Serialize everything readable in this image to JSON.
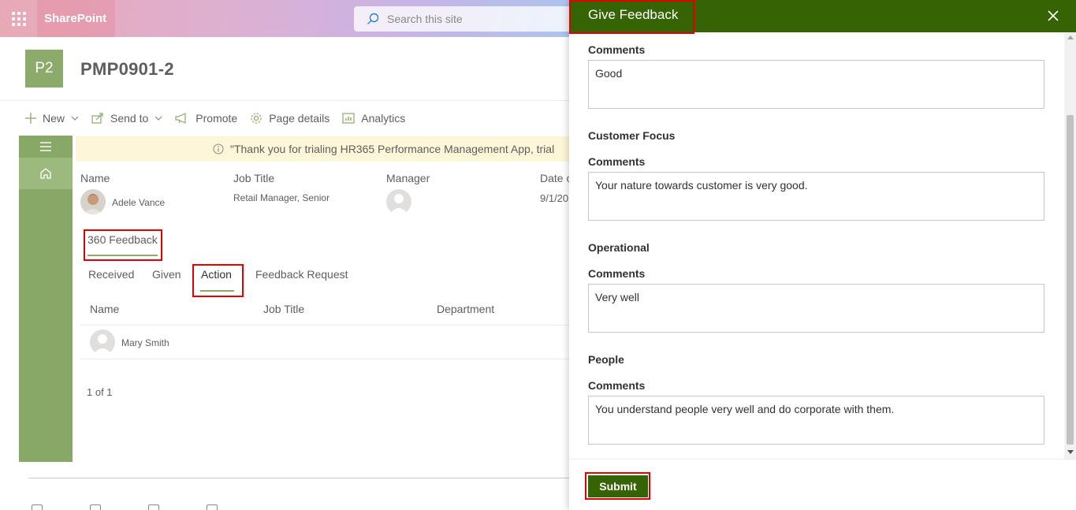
{
  "suitebar": {
    "app_name": "SharePoint",
    "search_placeholder": "Search this site"
  },
  "site": {
    "logo_initials": "P2",
    "title": "PMP0901-2"
  },
  "commandbar": {
    "new_label": "New",
    "send_to_label": "Send to",
    "promote_label": "Promote",
    "page_details_label": "Page details",
    "analytics_label": "Analytics"
  },
  "notice": {
    "text": "\"Thank you for trialing HR365 Performance Management App, trial"
  },
  "employee": {
    "name_label": "Name",
    "name_value": "Adele Vance",
    "job_title_label": "Job Title",
    "job_title_value": "Retail Manager, Senior",
    "manager_label": "Manager",
    "date_label": "Date o",
    "date_value": "9/1/20"
  },
  "feedback_tab": {
    "label": "360 Feedback"
  },
  "subtabs": {
    "received": "Received",
    "given": "Given",
    "action": "Action",
    "feedback_request": "Feedback Request"
  },
  "table": {
    "headers": {
      "name": "Name",
      "job_title": "Job Title",
      "department": "Department"
    },
    "rows": [
      {
        "name": "Mary Smith"
      }
    ]
  },
  "pager": {
    "text": "1 of 1"
  },
  "panel": {
    "title": "Give Feedback",
    "submit_label": "Submit",
    "first_comment_label": "Comments",
    "first_comment_value": "Good",
    "sections": [
      {
        "title": "Customer Focus",
        "comment_label": "Comments",
        "comment_value": "Your nature towards customer is very good."
      },
      {
        "title": "Operational",
        "comment_label": "Comments",
        "comment_value": "Very well"
      },
      {
        "title": "People",
        "comment_label": "Comments",
        "comment_value": "You understand people very well and do corporate with them."
      }
    ]
  },
  "colors": {
    "panel_header": "#366304",
    "rail": "#88a868",
    "highlight": "#e00000"
  }
}
